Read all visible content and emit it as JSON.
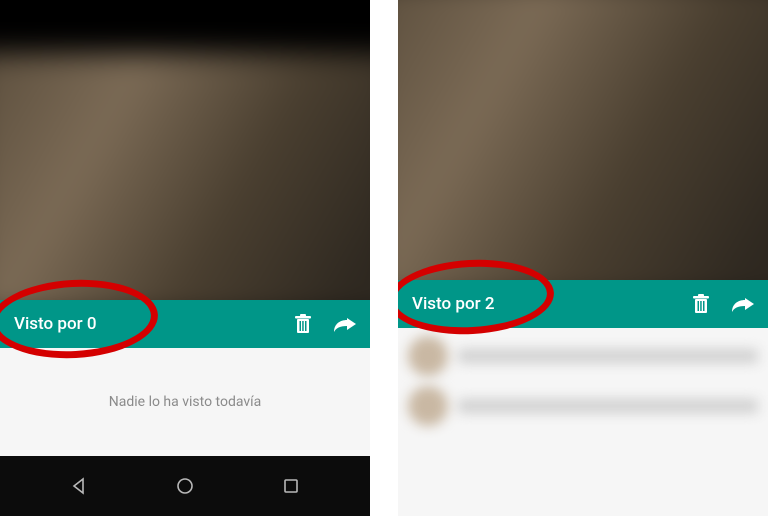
{
  "phones": [
    {
      "viewed_by_label": "Visto por 0",
      "empty_message": "Nadie lo ha visto todavía",
      "viewers": []
    },
    {
      "viewed_by_label": "Visto por 2",
      "empty_message": "",
      "viewers": [
        {
          "name": "",
          "time": ""
        },
        {
          "name": "",
          "time": ""
        }
      ]
    }
  ],
  "icons": {
    "delete": "trash-icon",
    "forward": "forward-icon",
    "nav_back": "triangle-back",
    "nav_home": "circle-home",
    "nav_recent": "square-recent"
  },
  "colors": {
    "bar": "#009688",
    "highlight_ring": "#d40000"
  }
}
